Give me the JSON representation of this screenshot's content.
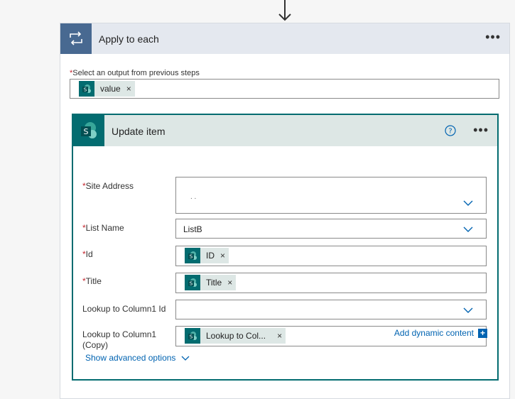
{
  "apply_each": {
    "title": "Apply to each",
    "select_label": "Select an output from previous steps",
    "required_mark": "*",
    "token": {
      "label": "value",
      "remove": "×"
    }
  },
  "update_item": {
    "title": "Update item",
    "fields": {
      "site_address": {
        "label": "Site Address",
        "value": ".                    ."
      },
      "list_name": {
        "label": "List Name",
        "value": "ListB"
      },
      "id": {
        "label": "Id",
        "token": "ID",
        "remove": "×"
      },
      "title": {
        "label": "Title",
        "token": "Title",
        "remove": "×"
      },
      "lookup_id": {
        "label": "Lookup to Column1 Id",
        "value": ""
      },
      "lookup_copy": {
        "label": "Lookup to Column1 (Copy)",
        "token": "Lookup to Col...",
        "remove": "×"
      }
    },
    "add_dynamic_label": "Add dynamic content",
    "add_dynamic_plus": "+",
    "show_advanced_label": "Show advanced options"
  },
  "colors": {
    "loop_blue": "#486991",
    "sharepoint_teal": "#036c70",
    "link_blue": "#0063b1",
    "required_red": "#c4262e"
  },
  "icons": [
    "arrow-down-icon",
    "loop-icon",
    "sharepoint-icon",
    "help-icon",
    "chevron-down-icon",
    "more-icon"
  ]
}
